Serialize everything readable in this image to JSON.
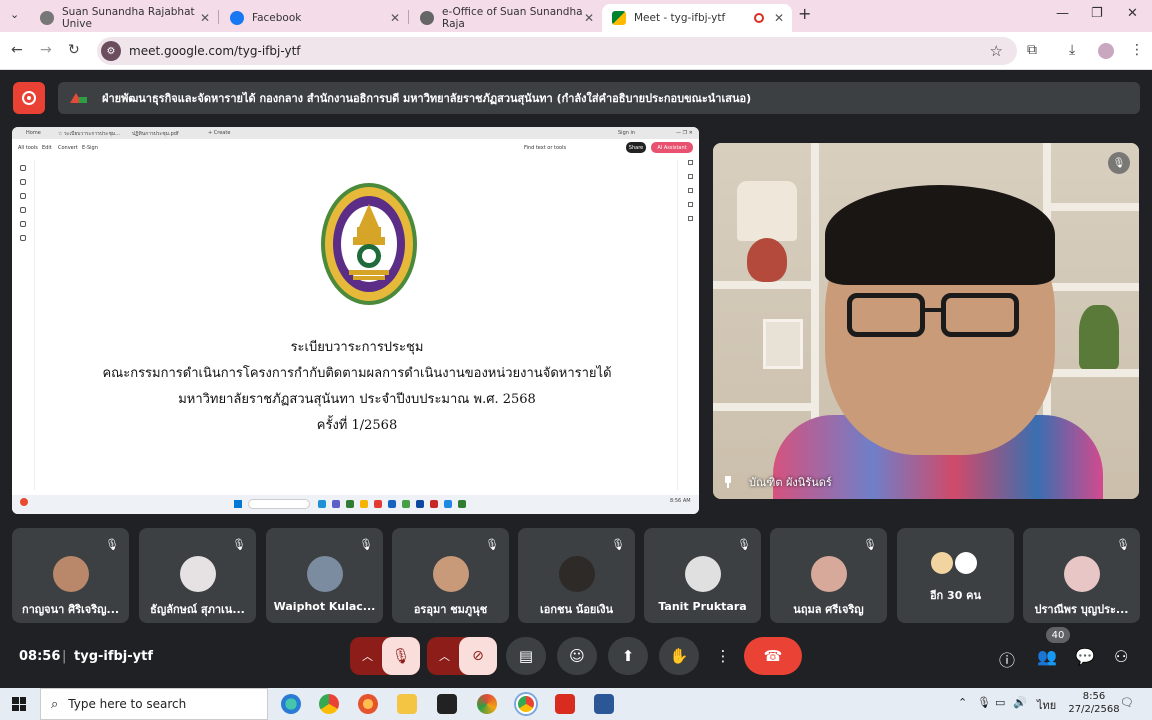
{
  "browser": {
    "tabs": [
      {
        "title": "Suan Sunandha Rajabhat Unive",
        "favicon": "globe-icon"
      },
      {
        "title": "Facebook",
        "favicon": "facebook-icon"
      },
      {
        "title": "e-Office of Suan Sunandha Raja",
        "favicon": "globe-icon"
      },
      {
        "title": "Meet - tyg-ifbj-ytf",
        "favicon": "meet-icon"
      }
    ],
    "new_tab_label": "+",
    "url": "meet.google.com/tyg-ifbj-ytf"
  },
  "meet": {
    "presenting_text": "ฝ่ายพัฒนาธุรกิจและจัดหารายได้ กองกลาง สำนักงานอธิการบดี มหาวิทยาลัยราชภัฏสวนสุนันทา (กำลังใส่คำอธิบายประกอบขณะนำเสนอ)",
    "shared_doc": {
      "lines": [
        "ระเบียบวาระการประชุม",
        "คณะกรรมการดำเนินการโครงการกำกับติดตามผลการดำเนินงานของหน่วยงานจัดหารายได้",
        "มหาวิทยาลัยราชภัฏสวนสุนันทา ประจำปีงบประมาณ พ.ศ. 2568",
        "ครั้งที่ 1/2568"
      ],
      "seal_text": "SUAN SUNANDHA RAJABHAT UNIVERSITY",
      "share_label": "Share",
      "ai_label": "AI Assistant",
      "find_label": "Find text or tools"
    },
    "speaker_name": "บัณฑิต ผังนิรันดร์",
    "participants": [
      {
        "name": "กาญจนา ศิริเจริญ...",
        "avatar_color": "#b9876a"
      },
      {
        "name": "ธัญลักษณ์ สุภาเน...",
        "avatar_color": "#d9c9c0"
      },
      {
        "name": "Waiphot Kulac...",
        "avatar_color": "#7b8ba0"
      },
      {
        "name": "อรอุมา ชมภูนุช",
        "avatar_color": "#c89a7a"
      },
      {
        "name": "เอกชน น้อยเงิน",
        "avatar_color": "#2e2a28"
      },
      {
        "name": "Tanit Pruktara",
        "avatar_color": "#e0e0e0"
      },
      {
        "name": "นฤมล ศรีเจริญ",
        "avatar_color": "#d7a99a"
      },
      {
        "name": "อีก 30 คน",
        "avatar_color": "#f2d4a0"
      },
      {
        "name": "ปราณีพร บุญประ...",
        "avatar_color": "#e8c6c6"
      }
    ],
    "clock": "08:56",
    "meeting_code": "tyg-ifbj-ytf",
    "participant_count": "40"
  },
  "taskbar": {
    "search_placeholder": "Type here to search",
    "lang": "ไทย",
    "time": "8:56",
    "date": "27/2/2568"
  }
}
